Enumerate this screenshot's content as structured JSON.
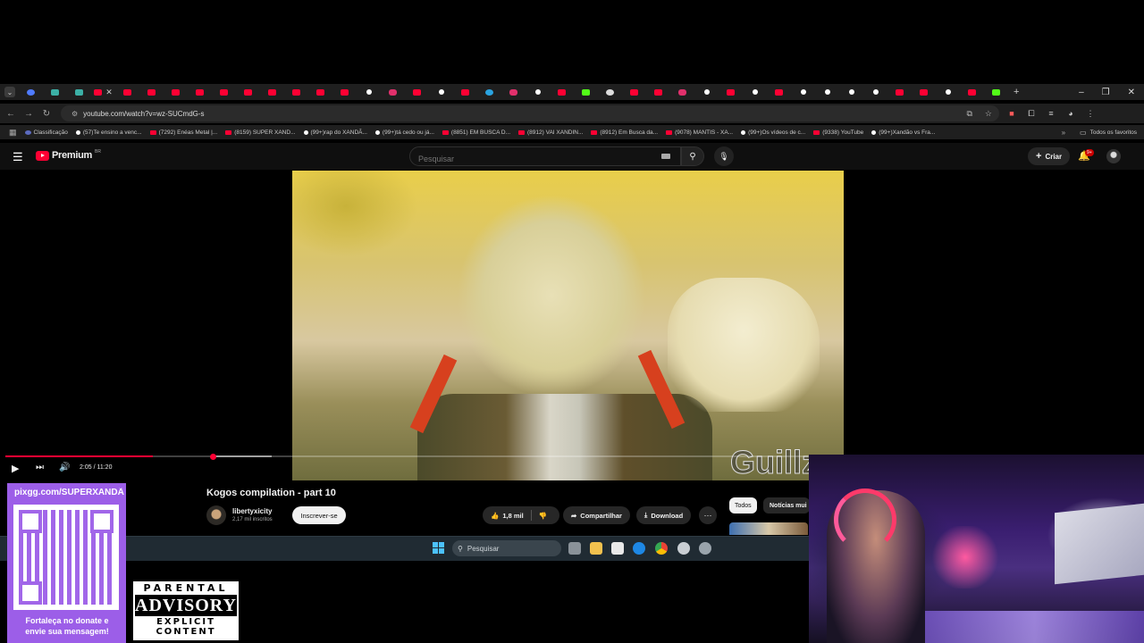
{
  "browser": {
    "tabs": [
      {
        "icon": "blue"
      },
      {
        "icon": "teal"
      },
      {
        "icon": "teal"
      },
      {
        "icon": "yt",
        "active": true
      },
      {
        "icon": "yt"
      },
      {
        "icon": "yt"
      },
      {
        "icon": "yt"
      },
      {
        "icon": "yt"
      },
      {
        "icon": "yt"
      },
      {
        "icon": "yt"
      },
      {
        "icon": "yt"
      },
      {
        "icon": "yt"
      },
      {
        "icon": "yt"
      },
      {
        "icon": "yt"
      },
      {
        "icon": "tt"
      },
      {
        "icon": "ig"
      },
      {
        "icon": "yt"
      },
      {
        "icon": "tt"
      },
      {
        "icon": "yt"
      },
      {
        "icon": "tg"
      },
      {
        "icon": "ig"
      },
      {
        "icon": "tt"
      },
      {
        "icon": "yt"
      },
      {
        "icon": "k"
      },
      {
        "icon": "g"
      },
      {
        "icon": "yt"
      },
      {
        "icon": "yt"
      },
      {
        "icon": "ig"
      },
      {
        "icon": "tt"
      },
      {
        "icon": "yt"
      },
      {
        "icon": "tt"
      },
      {
        "icon": "yt"
      },
      {
        "icon": "tt"
      },
      {
        "icon": "tt"
      },
      {
        "icon": "tt"
      },
      {
        "icon": "tt"
      },
      {
        "icon": "yt"
      },
      {
        "icon": "yt"
      },
      {
        "icon": "tt"
      },
      {
        "icon": "yt"
      },
      {
        "icon": "k"
      }
    ],
    "new_tab": "+",
    "url": "youtube.com/watch?v=wz-SUCmdG-s",
    "bookmarks": [
      {
        "icon": "cl",
        "label": "Classificação"
      },
      {
        "icon": "tt",
        "label": "(57)Te ensino a venc..."
      },
      {
        "icon": "yt",
        "label": "(7292) Enéas Metal |..."
      },
      {
        "icon": "yt",
        "label": "(8159) SUPER XAND..."
      },
      {
        "icon": "tt",
        "label": "(99+)rap do XANDÃ..."
      },
      {
        "icon": "tt",
        "label": "(99+)tá cedo ou já..."
      },
      {
        "icon": "yt",
        "label": "(8851) EM BUSCA D..."
      },
      {
        "icon": "yt",
        "label": "(8912) VAI XANDIN..."
      },
      {
        "icon": "yt",
        "label": "(8912) Em Busca da..."
      },
      {
        "icon": "yt",
        "label": "(9078) MANTIS - XA..."
      },
      {
        "icon": "tt",
        "label": "(99+)Os vídeos de c..."
      },
      {
        "icon": "yt",
        "label": "(9338) YouTube"
      },
      {
        "icon": "tt",
        "label": "(99+)Xandão vs Fra..."
      }
    ],
    "all_bookmarks": "Todos os favoritos"
  },
  "youtube": {
    "logo_text": "Premium",
    "logo_country": "BR",
    "search_placeholder": "Pesquisar",
    "create_label": "Criar",
    "notifications_badge": "9+",
    "player": {
      "current_time": "2:05",
      "duration": "11:20",
      "time_display": "2:05 / 11:20",
      "progress_fraction": 0.184
    },
    "watermark": "Guillz",
    "video_title": "Kogos compilation - part 10",
    "channel_name": "libertyxicity",
    "subscribers": "2,17 mil inscritos",
    "subscribe_label": "Inscrever-se",
    "likes": "1,8 mil",
    "share_label": "Compartilhar",
    "download_label": "Download",
    "chips": {
      "all": "Todos",
      "news": "Notícias mui"
    }
  },
  "taskbar": {
    "search_label": "Pesquisar"
  },
  "overlay": {
    "donate_url": "pixgg.com/SUPERXANDÃ",
    "donate_message_line1": "Fortaleça no donate e",
    "donate_message_line2": "envie sua mensagem!",
    "advisory_top": "PARENTAL",
    "advisory_mid": "ADVISORY",
    "advisory_bot": "EXPLICIT CONTENT"
  },
  "colors": {
    "yt_red": "#ff0033",
    "donate_purple": "#9c5ee8",
    "page_bg": "#0f0f0f"
  }
}
